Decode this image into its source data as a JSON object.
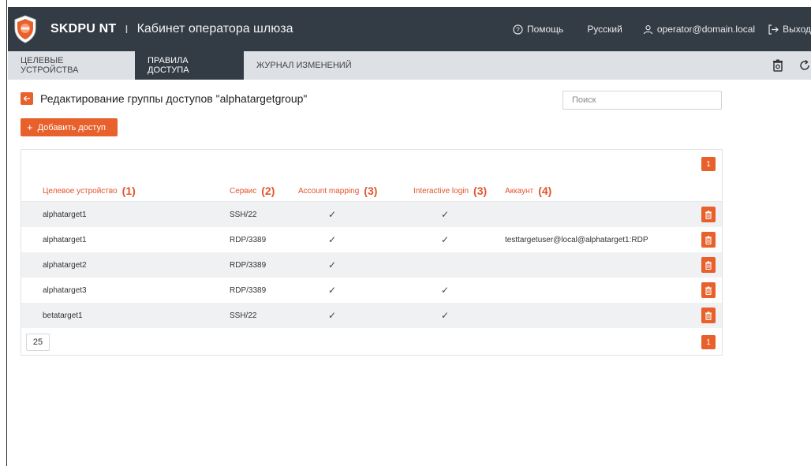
{
  "header": {
    "brand": "SKDPU NT",
    "separator": "I",
    "subtitle": "Кабинет оператора шлюза",
    "help": "Помощь",
    "language": "Русский",
    "user": "operator@domain.local",
    "logout": "Выход",
    "logo_icon": "shield-logo-icon",
    "colors": {
      "background": "#333b44"
    }
  },
  "tabs": [
    {
      "label": "ЦЕЛЕВЫЕ УСТРОЙСТВА",
      "active": false
    },
    {
      "label": "ПРАВИЛА ДОСТУПА",
      "active": true
    },
    {
      "label": "ЖУРНАЛ ИЗМЕНЕНИЙ",
      "active": false
    }
  ],
  "toolbar": {
    "delete_icon": "trash-icon",
    "refresh_icon": "refresh-icon"
  },
  "page": {
    "title": "Редактирование группы доступов \"alphatargetgroup\"",
    "back_icon": "arrow-left-icon"
  },
  "search": {
    "placeholder": "Поиск",
    "value": ""
  },
  "add_button": {
    "label": "Добавить доступ"
  },
  "table": {
    "page_top": "1",
    "page_bottom": "1",
    "page_size": "25",
    "columns": [
      {
        "label": "Целевое устройство",
        "marker": "(1)"
      },
      {
        "label": "Сервис",
        "marker": "(2)"
      },
      {
        "label": "Account mapping",
        "marker": "(3)"
      },
      {
        "label": "Interactive login",
        "marker": "(3)"
      },
      {
        "label": "Аккаунт",
        "marker": "(4)"
      }
    ],
    "rows": [
      {
        "device": "alphatarget1",
        "service": "SSH/22",
        "account_mapping": "✓",
        "interactive_login": "✓",
        "account": ""
      },
      {
        "device": "alphatarget1",
        "service": "RDP/3389",
        "account_mapping": "✓",
        "interactive_login": "✓",
        "account": "testtargetuser@local@alphatarget1:RDP"
      },
      {
        "device": "alphatarget2",
        "service": "RDP/3389",
        "account_mapping": "✓",
        "interactive_login": "",
        "account": ""
      },
      {
        "device": "alphatarget3",
        "service": "RDP/3389",
        "account_mapping": "✓",
        "interactive_login": "✓",
        "account": ""
      },
      {
        "device": "betatarget1",
        "service": "SSH/22",
        "account_mapping": "✓",
        "interactive_login": "✓",
        "account": ""
      }
    ]
  },
  "colors": {
    "accent": "#e8602c",
    "header_bg": "#333b44",
    "tabs_bg": "#dde1e5",
    "row_alt": "#f0f1f3"
  }
}
